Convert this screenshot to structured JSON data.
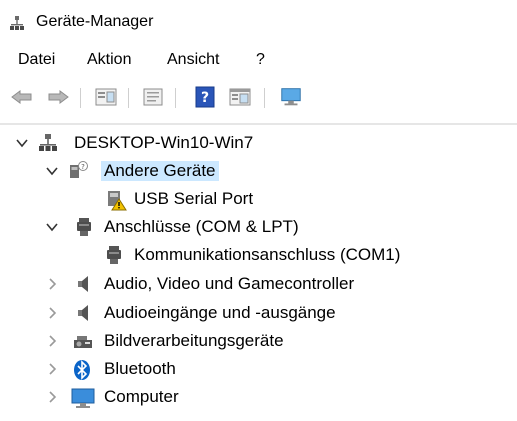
{
  "window": {
    "title": "Geräte-Manager"
  },
  "menu": [
    "Datei",
    "Aktion",
    "Ansicht",
    "?"
  ],
  "toolbar": {
    "icons": [
      "back-arrow-icon",
      "forward-arrow-icon",
      "properties-icon",
      "update-driver-icon",
      "help-icon",
      "details-view-icon",
      "scan-hardware-icon"
    ]
  },
  "tree": {
    "root": "DESKTOP-Win10-Win7",
    "nodes": [
      {
        "label": "Andere Geräte",
        "expanded": true,
        "selected": true
      },
      {
        "label": "USB Serial Port",
        "child": true,
        "warning": true
      },
      {
        "label": "Anschlüsse (COM & LPT)",
        "expanded": true
      },
      {
        "label": "Kommunikationsanschluss (COM1)",
        "child": true
      },
      {
        "label": "Audio, Video und Gamecontroller",
        "expanded": false
      },
      {
        "label": "Audioeingänge und -ausgänge",
        "expanded": false
      },
      {
        "label": "Bildverarbeitungsgeräte",
        "expanded": false
      },
      {
        "label": "Bluetooth",
        "expanded": false
      },
      {
        "label": "Computer",
        "expanded": false
      }
    ]
  },
  "colors": {
    "selection": "#cce8ff",
    "accent": "#0a64c8",
    "warning": "#f2c200"
  }
}
